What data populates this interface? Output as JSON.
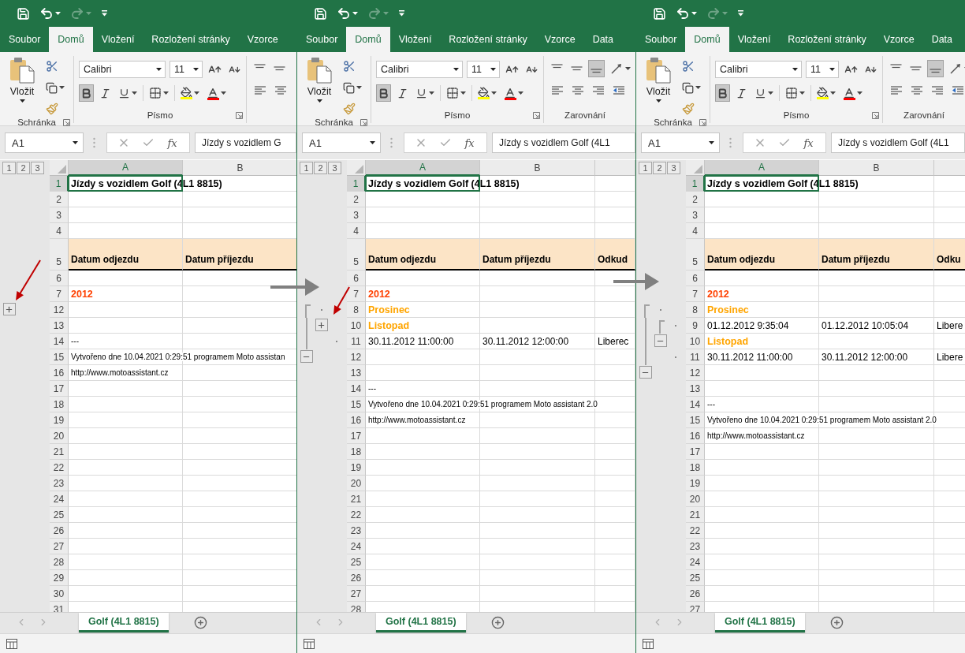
{
  "panels": [
    {
      "quick_access": [
        {
          "kind": "save",
          "disabled": false
        },
        {
          "kind": "undo",
          "disabled": false
        },
        {
          "kind": "redo",
          "disabled": true
        },
        {
          "kind": "customize",
          "disabled": false
        }
      ],
      "tabs": [
        {
          "label": "Soubor",
          "selected": false
        },
        {
          "label": "Domů",
          "selected": true
        },
        {
          "label": "Vložení",
          "selected": false
        },
        {
          "label": "Rozložení stránky",
          "selected": false
        },
        {
          "label": "Vzorce",
          "selected": false
        }
      ],
      "ribbon": {
        "paste_label": "Vložit",
        "font_name": "Calibri",
        "font_size": "11",
        "groups": [
          "Schránka",
          "Písmo"
        ],
        "format_buttons": [
          {
            "kind": "bold",
            "pressed": true
          },
          {
            "kind": "italic",
            "pressed": false
          },
          {
            "kind": "underline",
            "pressed": false
          }
        ],
        "align_rows": [
          [
            {
              "kind": "top",
              "pressed": false
            },
            {
              "kind": "middle",
              "pressed": false
            }
          ],
          [
            {
              "kind": "left",
              "pressed": false
            },
            {
              "kind": "center",
              "pressed": false
            }
          ]
        ]
      },
      "name_box": "A1",
      "fx": "fx",
      "formula": "Jízdy s vozidlem G",
      "outline_levels": [
        "1",
        "2",
        "3"
      ],
      "columns": [
        {
          "label": "A",
          "selected": true
        },
        {
          "label": "B",
          "selected": false
        }
      ],
      "rows": [
        {
          "number": "1",
          "kind": "title",
          "selected": true,
          "cells": [
            "Jízdy s vozidlem Golf (4L1 8815)"
          ]
        },
        {
          "number": "2",
          "kind": "plain",
          "selected": false
        },
        {
          "number": "3",
          "kind": "plain",
          "selected": false
        },
        {
          "number": "4",
          "kind": "plain",
          "selected": false
        },
        {
          "number": "5",
          "kind": "header",
          "selected": false,
          "cells": [
            "Datum odjezdu",
            "Datum příjezdu"
          ]
        },
        {
          "number": "6",
          "kind": "plain",
          "selected": false
        },
        {
          "number": "7",
          "kind": "year",
          "selected": false,
          "cells": [
            "2012"
          ]
        },
        {
          "number": "12",
          "kind": "plain",
          "selected": false,
          "outline": [
            {
              "kind": "toggle",
              "expanded": false
            }
          ]
        },
        {
          "number": "13",
          "kind": "plain",
          "selected": false
        },
        {
          "number": "14",
          "kind": "note",
          "selected": false,
          "cells": [
            "---"
          ]
        },
        {
          "number": "15",
          "kind": "note",
          "selected": false,
          "cells": [
            "Vytvořeno dne 10.04.2021 0:29:51 programem Moto assistan"
          ]
        },
        {
          "number": "16",
          "kind": "note",
          "selected": false,
          "cells": [
            "http://www.motoassistant.cz"
          ]
        },
        {
          "number": "17",
          "kind": "plain",
          "selected": false
        },
        {
          "number": "18",
          "kind": "plain",
          "selected": false
        },
        {
          "number": "19",
          "kind": "plain",
          "selected": false
        },
        {
          "number": "20",
          "kind": "plain",
          "selected": false
        },
        {
          "number": "21",
          "kind": "plain",
          "selected": false
        },
        {
          "number": "22",
          "kind": "plain",
          "selected": false
        },
        {
          "number": "23",
          "kind": "plain",
          "selected": false
        },
        {
          "number": "24",
          "kind": "plain",
          "selected": false
        },
        {
          "number": "25",
          "kind": "plain",
          "selected": false
        },
        {
          "number": "26",
          "kind": "plain",
          "selected": false
        },
        {
          "number": "27",
          "kind": "plain",
          "selected": false
        },
        {
          "number": "28",
          "kind": "plain",
          "selected": false
        },
        {
          "number": "29",
          "kind": "plain",
          "selected": false
        },
        {
          "number": "30",
          "kind": "plain",
          "selected": false
        },
        {
          "number": "31",
          "kind": "plain",
          "selected": false
        }
      ],
      "sheet_tabs": [
        {
          "label": "Golf (4L1 8815)",
          "selected": true
        }
      ]
    },
    {
      "quick_access": [
        {
          "kind": "save",
          "disabled": false
        },
        {
          "kind": "undo",
          "disabled": false
        },
        {
          "kind": "redo",
          "disabled": true
        },
        {
          "kind": "customize",
          "disabled": false
        }
      ],
      "tabs": [
        {
          "label": "Soubor",
          "selected": false
        },
        {
          "label": "Domů",
          "selected": true
        },
        {
          "label": "Vložení",
          "selected": false
        },
        {
          "label": "Rozložení stránky",
          "selected": false
        },
        {
          "label": "Vzorce",
          "selected": false
        },
        {
          "label": "Data",
          "selected": false
        }
      ],
      "ribbon": {
        "paste_label": "Vložit",
        "font_name": "Calibri",
        "font_size": "11",
        "groups": [
          "Schránka",
          "Písmo",
          "Zarovnání"
        ],
        "format_buttons": [
          {
            "kind": "bold",
            "pressed": true
          },
          {
            "kind": "italic",
            "pressed": false
          },
          {
            "kind": "underline",
            "pressed": false
          }
        ],
        "align_rows": [
          [
            {
              "kind": "top",
              "pressed": false
            },
            {
              "kind": "middle",
              "pressed": false
            },
            {
              "kind": "bottom",
              "pressed": true
            },
            {
              "kind": "orientation",
              "pressed": false
            }
          ],
          [
            {
              "kind": "left",
              "pressed": false
            },
            {
              "kind": "center",
              "pressed": false
            },
            {
              "kind": "right",
              "pressed": false
            },
            {
              "kind": "indent-decrease",
              "pressed": false
            }
          ]
        ]
      },
      "name_box": "A1",
      "fx": "fx",
      "formula": "Jízdy s vozidlem Golf (4L1",
      "outline_levels": [
        "1",
        "2",
        "3"
      ],
      "columns": [
        {
          "label": "A",
          "selected": true
        },
        {
          "label": "B",
          "selected": false
        },
        {
          "selected": false
        }
      ],
      "rows": [
        {
          "number": "1",
          "kind": "title",
          "selected": true,
          "cells": [
            "Jízdy s vozidlem Golf (4L1 8815)"
          ]
        },
        {
          "number": "2",
          "kind": "plain",
          "selected": false
        },
        {
          "number": "3",
          "kind": "plain",
          "selected": false
        },
        {
          "number": "4",
          "kind": "plain",
          "selected": false
        },
        {
          "number": "5",
          "kind": "header",
          "selected": false,
          "cells": [
            "Datum odjezdu",
            "Datum příjezdu",
            "Odkud"
          ]
        },
        {
          "number": "6",
          "kind": "plain",
          "selected": false
        },
        {
          "number": "7",
          "kind": "year",
          "selected": false,
          "cells": [
            "2012"
          ]
        },
        {
          "number": "8",
          "kind": "month",
          "selected": false,
          "cells": [
            "Prosinec"
          ],
          "outline": [
            {
              "kind": "top"
            },
            {
              "kind": "dot"
            }
          ]
        },
        {
          "number": "10",
          "kind": "month",
          "selected": false,
          "cells": [
            "Listopad"
          ],
          "outline": [
            {
              "kind": "line"
            },
            {
              "kind": "toggle",
              "expanded": false
            }
          ]
        },
        {
          "number": "11",
          "kind": "data",
          "selected": false,
          "cells": [
            "30.11.2012 11:00:00",
            "30.11.2012 12:00:00",
            "Liberec"
          ],
          "outline": [
            {
              "kind": "line"
            },
            {
              "kind": "none"
            },
            {
              "kind": "dot"
            }
          ]
        },
        {
          "number": "12",
          "kind": "plain",
          "selected": false,
          "outline": [
            {
              "kind": "toggle",
              "expanded": true
            }
          ]
        },
        {
          "number": "13",
          "kind": "plain",
          "selected": false
        },
        {
          "number": "14",
          "kind": "note",
          "selected": false,
          "cells": [
            "---"
          ]
        },
        {
          "number": "15",
          "kind": "note",
          "selected": false,
          "cells": [
            "Vytvořeno dne 10.04.2021 0:29:51 programem Moto assistant 2.0"
          ]
        },
        {
          "number": "16",
          "kind": "note",
          "selected": false,
          "cells": [
            "http://www.motoassistant.cz"
          ]
        },
        {
          "number": "17",
          "kind": "plain",
          "selected": false
        },
        {
          "number": "18",
          "kind": "plain",
          "selected": false
        },
        {
          "number": "19",
          "kind": "plain",
          "selected": false
        },
        {
          "number": "20",
          "kind": "plain",
          "selected": false
        },
        {
          "number": "21",
          "kind": "plain",
          "selected": false
        },
        {
          "number": "22",
          "kind": "plain",
          "selected": false
        },
        {
          "number": "23",
          "kind": "plain",
          "selected": false
        },
        {
          "number": "24",
          "kind": "plain",
          "selected": false
        },
        {
          "number": "25",
          "kind": "plain",
          "selected": false
        },
        {
          "number": "26",
          "kind": "plain",
          "selected": false
        },
        {
          "number": "27",
          "kind": "plain",
          "selected": false
        },
        {
          "number": "28",
          "kind": "plain",
          "selected": false
        }
      ],
      "sheet_tabs": [
        {
          "label": "Golf (4L1 8815)",
          "selected": true
        }
      ]
    },
    {
      "quick_access": [
        {
          "kind": "save",
          "disabled": false
        },
        {
          "kind": "undo",
          "disabled": false
        },
        {
          "kind": "redo",
          "disabled": true
        },
        {
          "kind": "customize",
          "disabled": false
        }
      ],
      "tabs": [
        {
          "label": "Soubor",
          "selected": false
        },
        {
          "label": "Domů",
          "selected": true
        },
        {
          "label": "Vložení",
          "selected": false
        },
        {
          "label": "Rozložení stránky",
          "selected": false
        },
        {
          "label": "Vzorce",
          "selected": false
        },
        {
          "label": "Data",
          "selected": false
        }
      ],
      "ribbon": {
        "paste_label": "Vložit",
        "font_name": "Calibri",
        "font_size": "11",
        "groups": [
          "Schránka",
          "Písmo",
          "Zarovnání"
        ],
        "format_buttons": [
          {
            "kind": "bold",
            "pressed": true
          },
          {
            "kind": "italic",
            "pressed": false
          },
          {
            "kind": "underline",
            "pressed": false
          }
        ],
        "align_rows": [
          [
            {
              "kind": "top",
              "pressed": false
            },
            {
              "kind": "middle",
              "pressed": false
            },
            {
              "kind": "bottom",
              "pressed": true
            },
            {
              "kind": "orientation",
              "pressed": false
            }
          ],
          [
            {
              "kind": "left",
              "pressed": false
            },
            {
              "kind": "center",
              "pressed": false
            },
            {
              "kind": "right",
              "pressed": false
            },
            {
              "kind": "indent-decrease",
              "pressed": false
            }
          ]
        ]
      },
      "name_box": "A1",
      "fx": "fx",
      "formula": "Jízdy s vozidlem Golf (4L1",
      "outline_levels": [
        "1",
        "2",
        "3"
      ],
      "columns": [
        {
          "label": "A",
          "selected": true
        },
        {
          "label": "B",
          "selected": false
        },
        {
          "selected": false
        }
      ],
      "rows": [
        {
          "number": "1",
          "kind": "title",
          "selected": true,
          "cells": [
            "Jízdy s vozidlem Golf (4L1 8815)"
          ]
        },
        {
          "number": "2",
          "kind": "plain",
          "selected": false
        },
        {
          "number": "3",
          "kind": "plain",
          "selected": false
        },
        {
          "number": "4",
          "kind": "plain",
          "selected": false
        },
        {
          "number": "5",
          "kind": "header",
          "selected": false,
          "cells": [
            "Datum odjezdu",
            "Datum příjezdu",
            "Odku"
          ]
        },
        {
          "number": "6",
          "kind": "plain",
          "selected": false
        },
        {
          "number": "7",
          "kind": "year",
          "selected": false,
          "cells": [
            "2012"
          ]
        },
        {
          "number": "8",
          "kind": "month",
          "selected": false,
          "cells": [
            "Prosinec"
          ],
          "outline": [
            {
              "kind": "top"
            },
            {
              "kind": "dot"
            }
          ]
        },
        {
          "number": "9",
          "kind": "data",
          "selected": false,
          "cells": [
            "01.12.2012 9:35:04",
            "01.12.2012 10:05:04",
            "Libere"
          ],
          "outline": [
            {
              "kind": "line"
            },
            {
              "kind": "top"
            },
            {
              "kind": "dot"
            }
          ]
        },
        {
          "number": "10",
          "kind": "month",
          "selected": false,
          "cells": [
            "Listopad"
          ],
          "outline": [
            {
              "kind": "line"
            },
            {
              "kind": "toggle",
              "expanded": true
            }
          ]
        },
        {
          "number": "11",
          "kind": "data",
          "selected": false,
          "cells": [
            "30.11.2012 11:00:00",
            "30.11.2012 12:00:00",
            "Libere"
          ],
          "outline": [
            {
              "kind": "line"
            },
            {
              "kind": "none"
            },
            {
              "kind": "dot"
            }
          ]
        },
        {
          "number": "12",
          "kind": "plain",
          "selected": false,
          "outline": [
            {
              "kind": "toggle",
              "expanded": true
            }
          ]
        },
        {
          "number": "13",
          "kind": "plain",
          "selected": false
        },
        {
          "number": "14",
          "kind": "note",
          "selected": false,
          "cells": [
            "---"
          ]
        },
        {
          "number": "15",
          "kind": "note",
          "selected": false,
          "cells": [
            "Vytvořeno dne 10.04.2021 0:29:51 programem Moto assistant 2.0"
          ]
        },
        {
          "number": "16",
          "kind": "note",
          "selected": false,
          "cells": [
            "http://www.motoassistant.cz"
          ]
        },
        {
          "number": "17",
          "kind": "plain",
          "selected": false
        },
        {
          "number": "18",
          "kind": "plain",
          "selected": false
        },
        {
          "number": "19",
          "kind": "plain",
          "selected": false
        },
        {
          "number": "20",
          "kind": "plain",
          "selected": false
        },
        {
          "number": "21",
          "kind": "plain",
          "selected": false
        },
        {
          "number": "22",
          "kind": "plain",
          "selected": false
        },
        {
          "number": "23",
          "kind": "plain",
          "selected": false
        },
        {
          "number": "24",
          "kind": "plain",
          "selected": false
        },
        {
          "number": "25",
          "kind": "plain",
          "selected": false
        },
        {
          "number": "26",
          "kind": "plain",
          "selected": false
        },
        {
          "number": "27",
          "kind": "plain",
          "selected": false
        }
      ],
      "sheet_tabs": [
        {
          "label": "Golf (4L1 8815)",
          "selected": true
        }
      ]
    }
  ]
}
